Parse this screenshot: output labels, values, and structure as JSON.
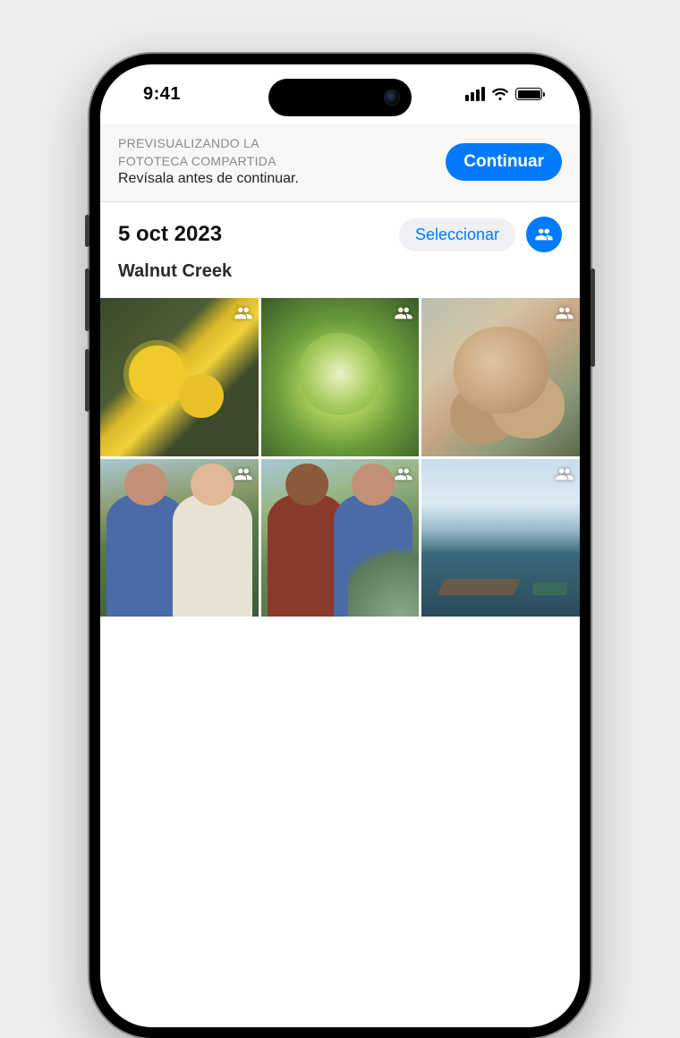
{
  "status_bar": {
    "time": "9:41"
  },
  "banner": {
    "title_line1": "PREVISUALIZANDO LA",
    "title_line2": "FOTOTECA COMPARTIDA",
    "subtitle": "Revísala antes de continuar.",
    "continue_label": "Continuar"
  },
  "section": {
    "date": "5 oct 2023",
    "select_label": "Seleccionar",
    "location": "Walnut Creek"
  },
  "colors": {
    "accent": "#007aff"
  },
  "photos": [
    {
      "desc": "yellow-flowers",
      "shared": true
    },
    {
      "desc": "green-succulent",
      "shared": true
    },
    {
      "desc": "tan-flower-clusters",
      "shared": true
    },
    {
      "desc": "two-men-garden",
      "shared": true
    },
    {
      "desc": "two-men-agave",
      "shared": true
    },
    {
      "desc": "harbor-dock",
      "shared": true
    }
  ]
}
